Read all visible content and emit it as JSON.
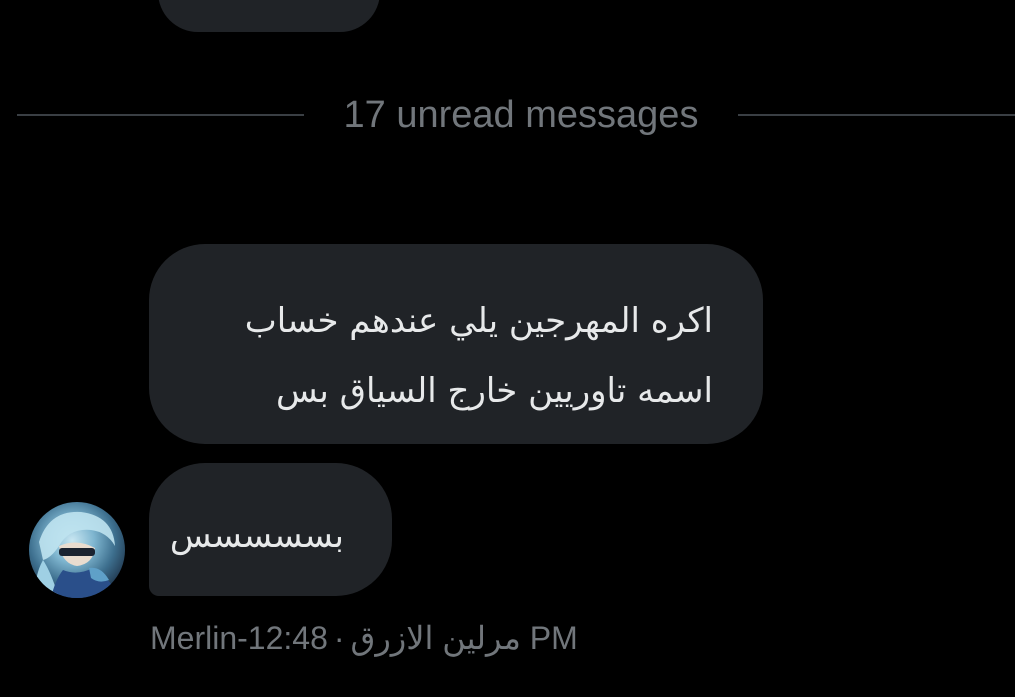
{
  "divider": {
    "label": "17 unread messages"
  },
  "messages": [
    {
      "lines": [
        "اكره المهرجين يلي عندهم خساب",
        "اسمه تاوريين خارج السياق بس"
      ]
    },
    {
      "lines": [
        "بسسسسس"
      ]
    }
  ],
  "meta": {
    "sender": "Merlin-12:48",
    "separator": "·",
    "time": "مرلين الازرق PM"
  },
  "colors": {
    "background": "#000000",
    "bubble": "#202327",
    "text": "#e7e9ea",
    "muted": "#71767b",
    "divider": "#3a3f44"
  },
  "icons": {
    "avatar": "user-avatar-image"
  }
}
